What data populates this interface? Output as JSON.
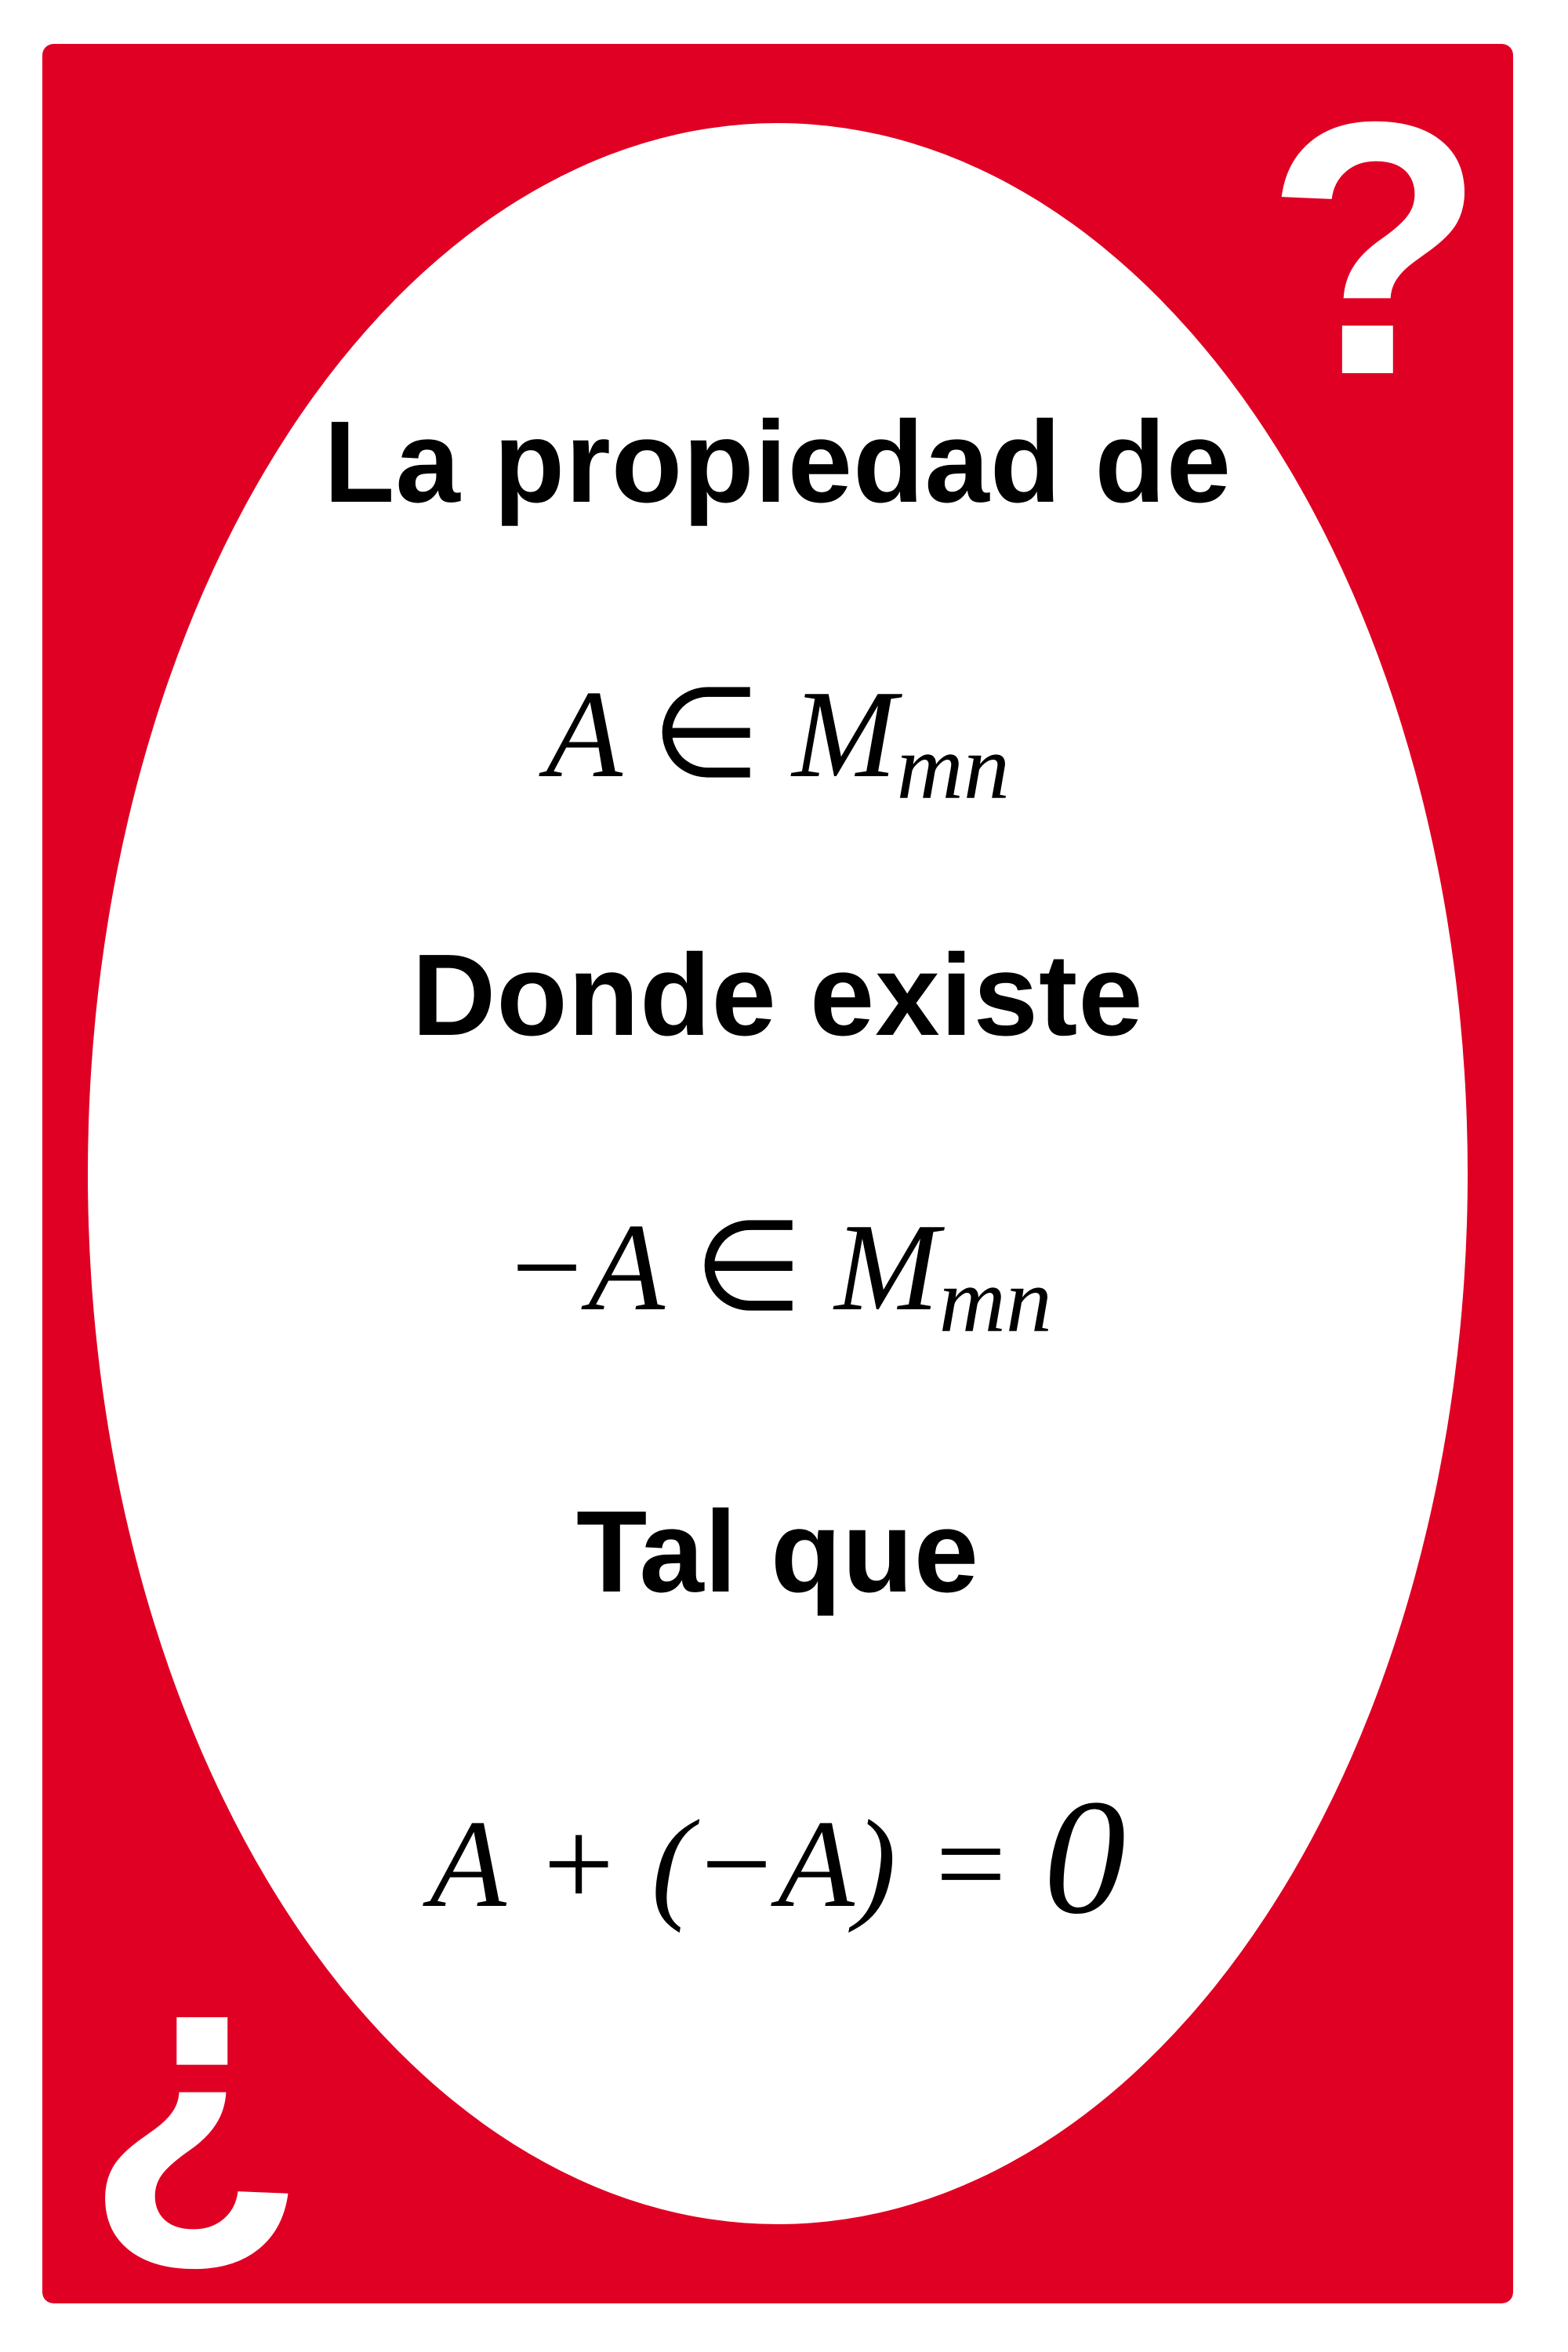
{
  "card": {
    "colors": {
      "frame": "#e00024",
      "oval": "#ffffff",
      "text": "#000000",
      "marks": "#ffffff"
    },
    "corner_marks": {
      "top_right": "?",
      "bottom_left": "¿",
      "top_right_icon": "question-mark-icon",
      "bottom_left_icon": "inverted-question-mark-icon"
    },
    "line1": "La propiedad de",
    "formula1": {
      "lhs": "A",
      "relation": "∈",
      "set": "M",
      "subscript": "mn"
    },
    "line2": "Donde existe",
    "formula2": {
      "lhs": "−A",
      "relation": "∈",
      "set": "M",
      "subscript": "mn"
    },
    "line3": "Tal que",
    "formula3": {
      "lhs": "A + (−A) =",
      "rhs": "0"
    }
  }
}
